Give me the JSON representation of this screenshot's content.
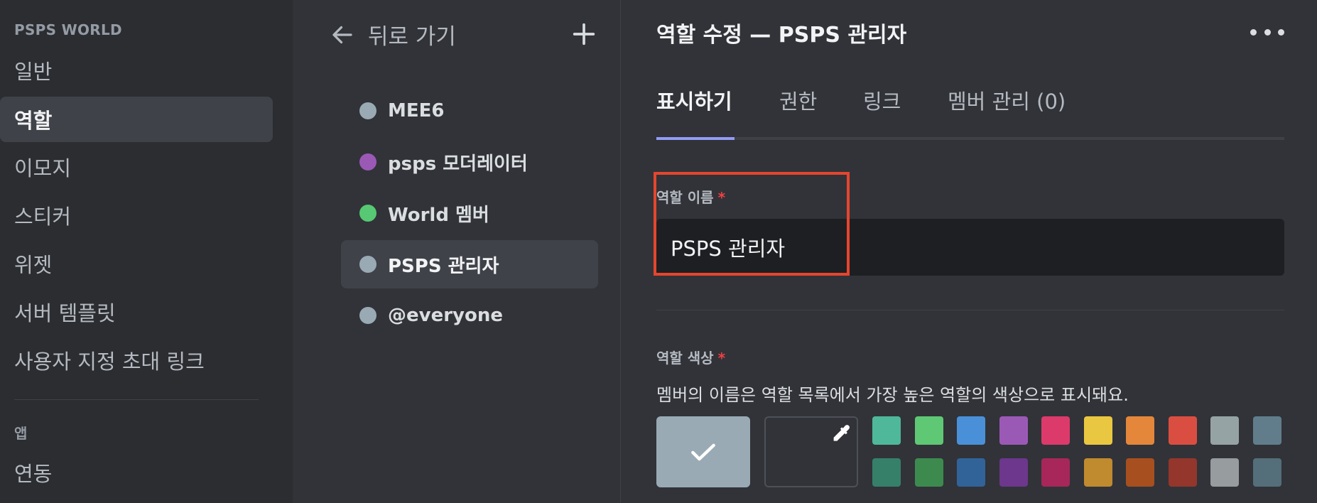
{
  "sidebar": {
    "server_name": "PSPS WORLD",
    "items": [
      {
        "label": "일반"
      },
      {
        "label": "역할"
      },
      {
        "label": "이모지"
      },
      {
        "label": "스티커"
      },
      {
        "label": "위젯"
      },
      {
        "label": "서버 템플릿"
      },
      {
        "label": "사용자 지정 초대 링크"
      }
    ],
    "selected_index": 1,
    "apps_header": "앱",
    "apps_items": [
      {
        "label": "연동"
      }
    ]
  },
  "rolelist": {
    "back_label": "뒤로 가기",
    "add_icon": "plus-icon",
    "roles": [
      {
        "name": "MEE6",
        "color": "#99aab5"
      },
      {
        "name": "psps 모더레이터",
        "color": "#9b59b6"
      },
      {
        "name": "World 멤버",
        "color": "#57c873"
      },
      {
        "name": "PSPS 관리자",
        "color": "#99aab5"
      },
      {
        "name": "@everyone",
        "color": "#99aab5"
      }
    ],
    "selected_index": 3
  },
  "main": {
    "title": "역할 수정 — PSPS 관리자",
    "more_icon": "more-horizontal-icon",
    "tabs": [
      {
        "label": "표시하기"
      },
      {
        "label": "권한"
      },
      {
        "label": "링크"
      },
      {
        "label": "멤버 관리 (0)"
      }
    ],
    "active_tab_index": 0,
    "role_name_label": "역할 이름",
    "required_mark": "*",
    "role_name_value": "PSPS 관리자",
    "role_color_label": "역할 색상",
    "role_color_desc": "멤버의 이름은 역할 목록에서 가장 높은 역할의 색상으로 표시돼요.",
    "default_color": "#99aab5",
    "custom_color_icon": "eyedropper-icon",
    "swatches_row1": [
      "#4fb89a",
      "#5ec874",
      "#4a90d8",
      "#9b59b6",
      "#dc3a6a",
      "#eac740",
      "#e4873b",
      "#da4e41",
      "#95a3a4",
      "#617d8c"
    ],
    "swatches_row2": [
      "#36806a",
      "#3d8a4f",
      "#316399",
      "#6c378c",
      "#a7275a",
      "#c08a2e",
      "#a74f1f",
      "#94362c",
      "#979c9f",
      "#546e7a"
    ]
  },
  "colors": {
    "accent": "#949cf7",
    "highlight": "#e5452f"
  }
}
